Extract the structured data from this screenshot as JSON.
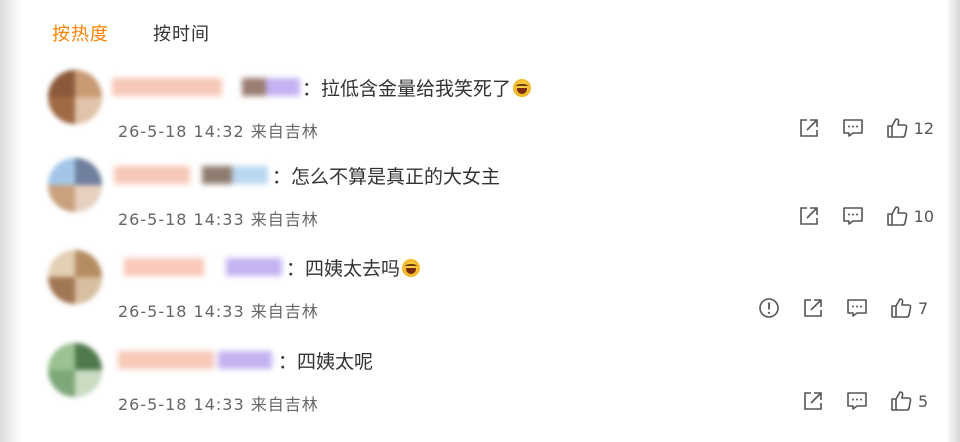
{
  "sort_tabs": [
    {
      "label": "按热度",
      "active": true
    },
    {
      "label": "按时间",
      "active": false
    }
  ],
  "accent_color": "#ff8200",
  "comments": [
    {
      "text": "拉低含金量给我笑死了",
      "has_emoji": true,
      "emoji": "laugh-cry",
      "prefix": "：",
      "date": "26-5-18",
      "time": "14:32",
      "source": "来自吉林",
      "like_count": "12",
      "actions": [
        "share-icon",
        "comment-icon",
        "like-icon"
      ]
    },
    {
      "text": "怎么不算是真正的大女主",
      "has_emoji": false,
      "prefix": "：",
      "date": "26-5-18",
      "time": "14:33",
      "source": "来自吉林",
      "like_count": "10",
      "actions": [
        "share-icon",
        "comment-icon",
        "like-icon"
      ]
    },
    {
      "text": "四姨太去吗",
      "has_emoji": true,
      "emoji": "laugh-cry",
      "prefix": "：",
      "date": "26-5-18",
      "time": "14:33",
      "source": "来自吉林",
      "like_count": "7",
      "actions": [
        "report-icon",
        "share-icon",
        "comment-icon",
        "like-icon"
      ]
    },
    {
      "text": "四姨太呢",
      "has_emoji": false,
      "prefix": "：",
      "date": "26-5-18",
      "time": "14:33",
      "source": "来自吉林",
      "like_count": "5",
      "actions": [
        "share-icon",
        "comment-icon",
        "like-icon"
      ]
    }
  ]
}
